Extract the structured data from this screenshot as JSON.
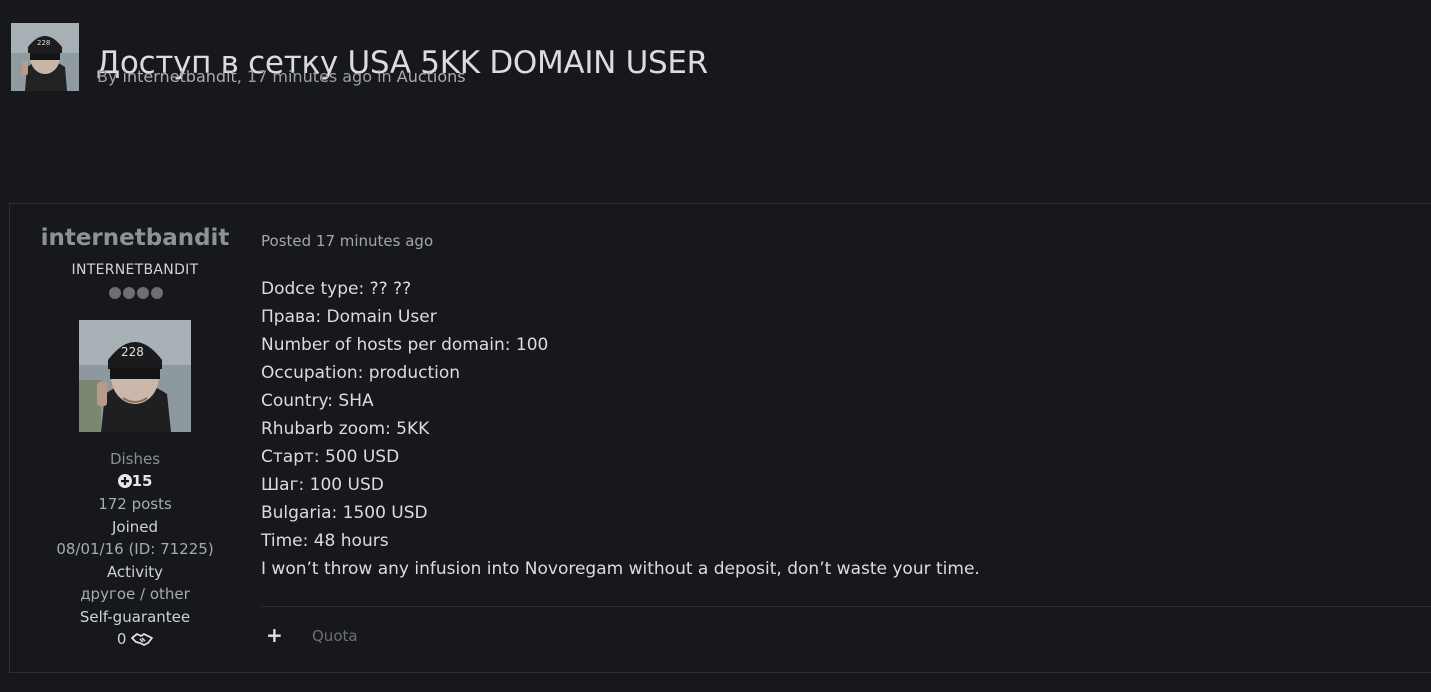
{
  "topic": {
    "title": "Доступ в сетку USA 5KK DOMAIN USER",
    "by_prefix": "By",
    "author": "internetbandit",
    "time_sep": ", 17 minutes ago in",
    "forum": "Auctions"
  },
  "author": {
    "name": "internetbandit",
    "title": "INTERNETBANDIT",
    "rank_dots": 4,
    "group": "Dishes",
    "reputation": "15",
    "posts": "172 posts",
    "joined_label": "Joined",
    "joined_value": "08/01/16 (ID: 71225)",
    "activity_label": "Activity",
    "activity_value": "другое / other",
    "guarantee_label": "Self-guarantee",
    "guarantee_value": "0"
  },
  "post": {
    "meta": "Posted 17 minutes ago",
    "lines": [
      "Dodce type: ?? ??",
      "Права: Domain User",
      "Number of hosts per domain: 100",
      "Occupation: production",
      "Country: SHA",
      "Rhubarb zoom: 5KK",
      "Старт: 500 USD",
      "Шаг: 100 USD",
      "Bulgaria: 1500 USD",
      "Time: 48 hours",
      "I won’t throw any infusion into Novoregam without a deposit, don’t waste your time."
    ],
    "plus_label": "+",
    "quote_label": "Quota"
  },
  "colors": {
    "background": "#17181c",
    "border": "#2e3035",
    "text": "#dcdcdc",
    "muted": "#8c9096"
  },
  "icons": {
    "reputation": "plus-circle-icon",
    "guarantee": "handshake-icon"
  }
}
